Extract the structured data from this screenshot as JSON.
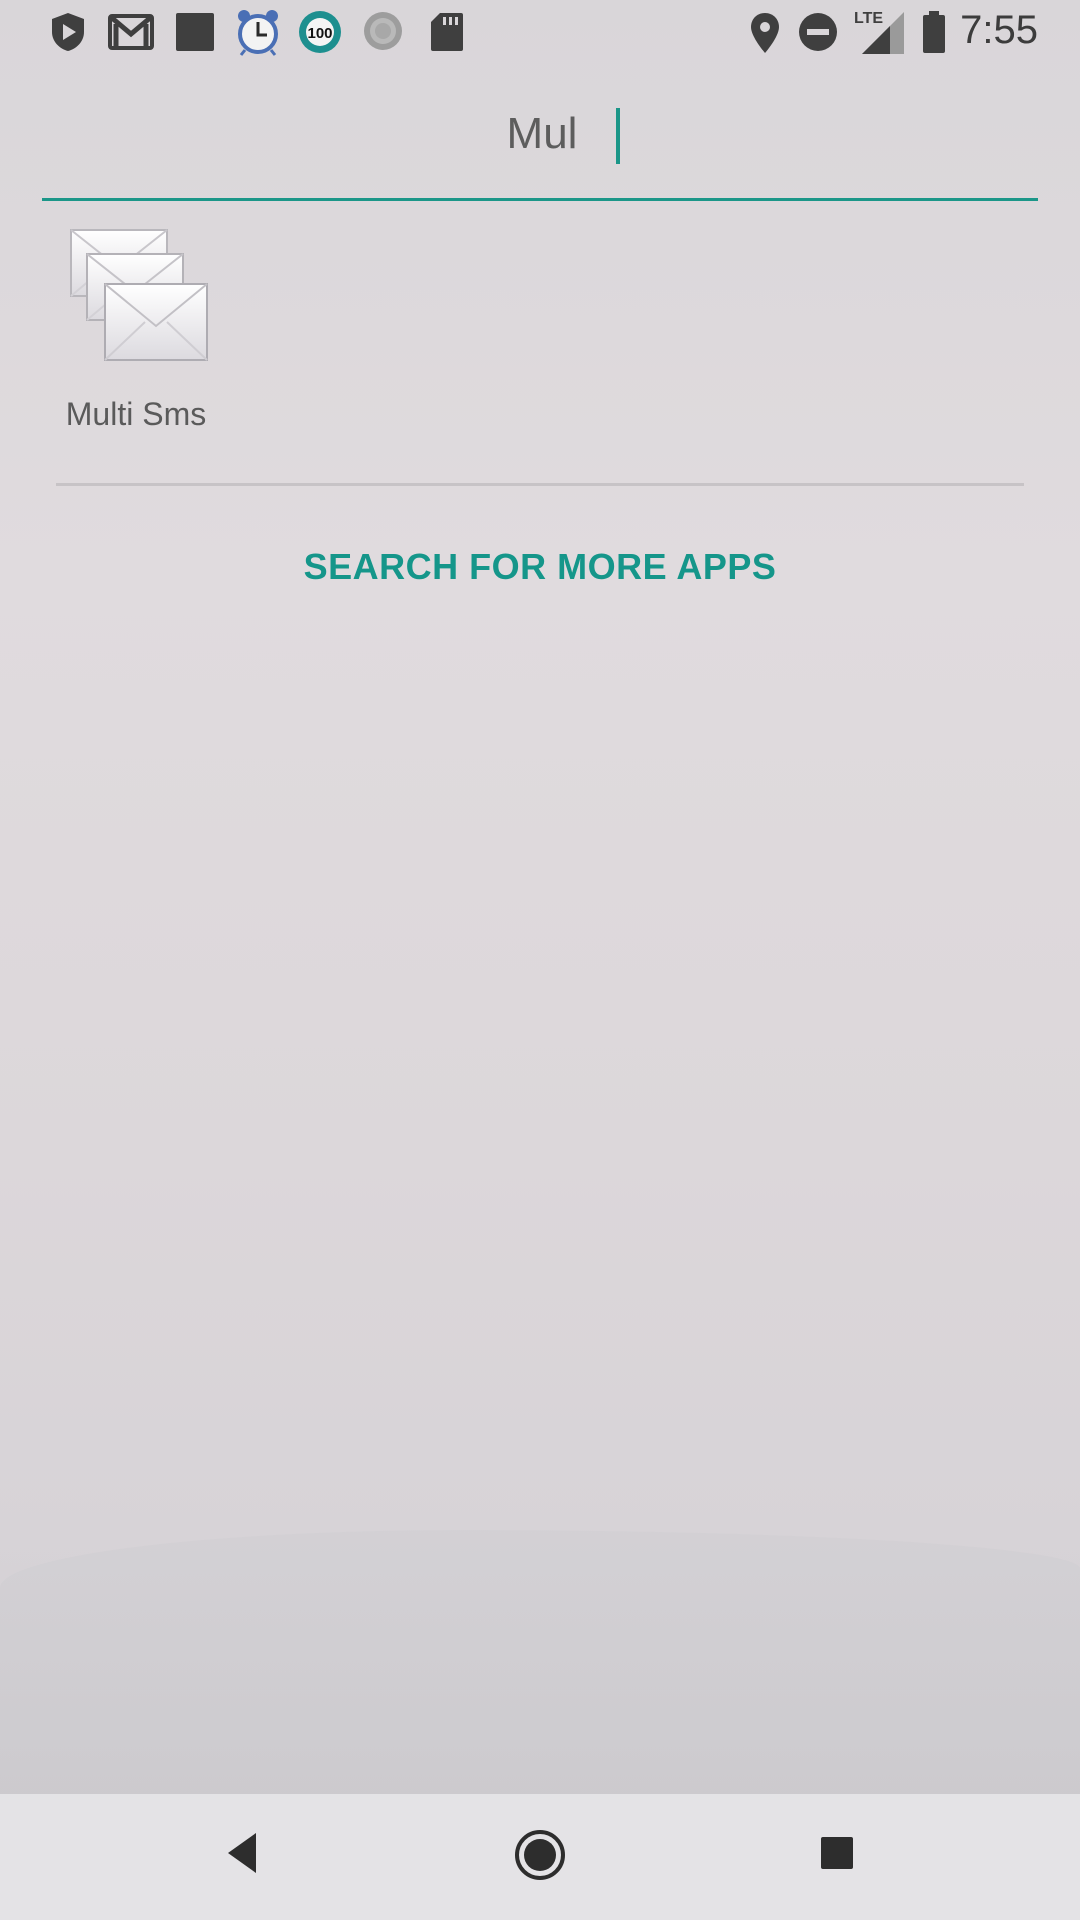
{
  "status_bar": {
    "time": "7:55",
    "icons_left": [
      "shield-play-icon",
      "gmail-icon",
      "square-app-icon",
      "alarm-clock-icon",
      "battery-100-icon",
      "sync-icon",
      "sd-card-icon"
    ],
    "badge_text": "100",
    "network": "LTE",
    "icons_right": [
      "location-icon",
      "do-not-disturb-icon",
      "signal-icon",
      "battery-icon"
    ]
  },
  "search": {
    "value": "Mul"
  },
  "results": [
    {
      "label": "Multi Sms",
      "icon": "multi-envelope-icon"
    }
  ],
  "more_apps_label": "SEARCH FOR MORE APPS",
  "nav": {
    "buttons": [
      "back-icon",
      "home-icon",
      "recents-icon"
    ]
  },
  "colors": {
    "accent": "#1b9688"
  }
}
